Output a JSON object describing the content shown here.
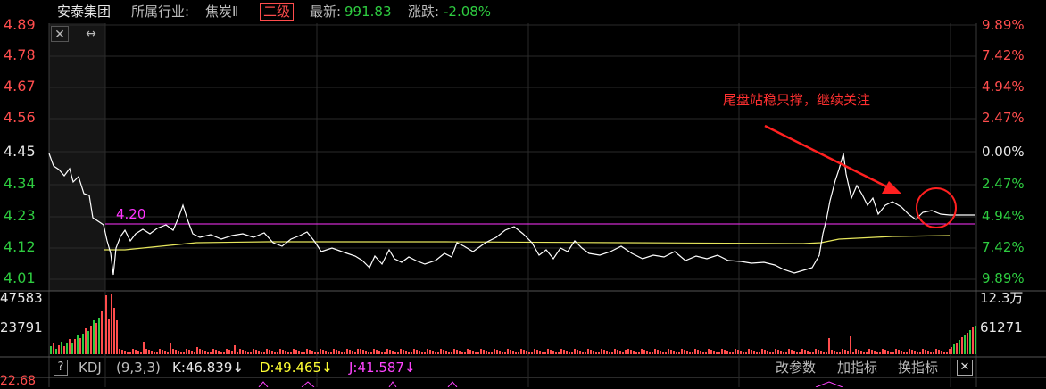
{
  "header": {
    "stock_name": "安泰集团",
    "industry_label": "所属行业:",
    "industry_value": "焦炭Ⅱ",
    "grade": "二级",
    "latest_label": "最新:",
    "latest_value": "991.83",
    "change_label": "涨跌:",
    "change_value": "-2.08%"
  },
  "price_axis": {
    "left": [
      "4.89",
      "4.78",
      "4.67",
      "4.56",
      "4.45",
      "4.34",
      "4.23",
      "4.12",
      "4.01"
    ],
    "right": [
      "9.89%",
      "7.42%",
      "4.94%",
      "2.47%",
      "0.00%",
      "2.47%",
      "4.94%",
      "7.42%",
      "9.89%"
    ]
  },
  "level_line_label": "4.20",
  "annotation_text": "尾盘站稳只撑，继续关注",
  "volume_axis": {
    "left": [
      "47583",
      "23791"
    ],
    "right": [
      "12.3万",
      "61271"
    ]
  },
  "kdj": {
    "help_label": "?",
    "name": "KDJ",
    "params": "(9,3,3)",
    "k": "K:46.839↓",
    "d": "D:49.465↓",
    "j": "J:41.587↓",
    "modify_params": "改参数",
    "add_indicator": "加指标",
    "switch_indicator": "换指标",
    "close": "✕"
  },
  "bottom_left_value": "22.68",
  "colors": {
    "up": "#ff4d4d",
    "down": "#2ecc40",
    "price_line": "#ffffff",
    "avg_line": "#e6e65c",
    "level_line": "#ff33ff",
    "grid": "#2a2a2a"
  }
}
